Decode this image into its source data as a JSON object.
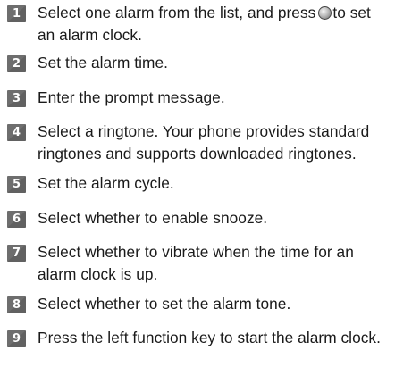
{
  "steps": [
    {
      "number": "1",
      "text_before": "Select one alarm from the list, and press",
      "icon": "ok-key-icon",
      "text_after": "to set an alarm clock."
    },
    {
      "number": "2",
      "text": "Set the alarm time."
    },
    {
      "number": "3",
      "text": "Enter the prompt message."
    },
    {
      "number": "4",
      "text": "Select a ringtone. Your phone provides standard ringtones and supports downloaded ringtones."
    },
    {
      "number": "5",
      "text": "Set the alarm cycle."
    },
    {
      "number": "6",
      "text": "Select whether to enable snooze."
    },
    {
      "number": "7",
      "text": "Select whether to vibrate when the time for an alarm clock is up."
    },
    {
      "number": "8",
      "text": "Select whether to set the alarm tone."
    },
    {
      "number": "9",
      "text": "Press the left function key to start the alarm clock."
    }
  ]
}
